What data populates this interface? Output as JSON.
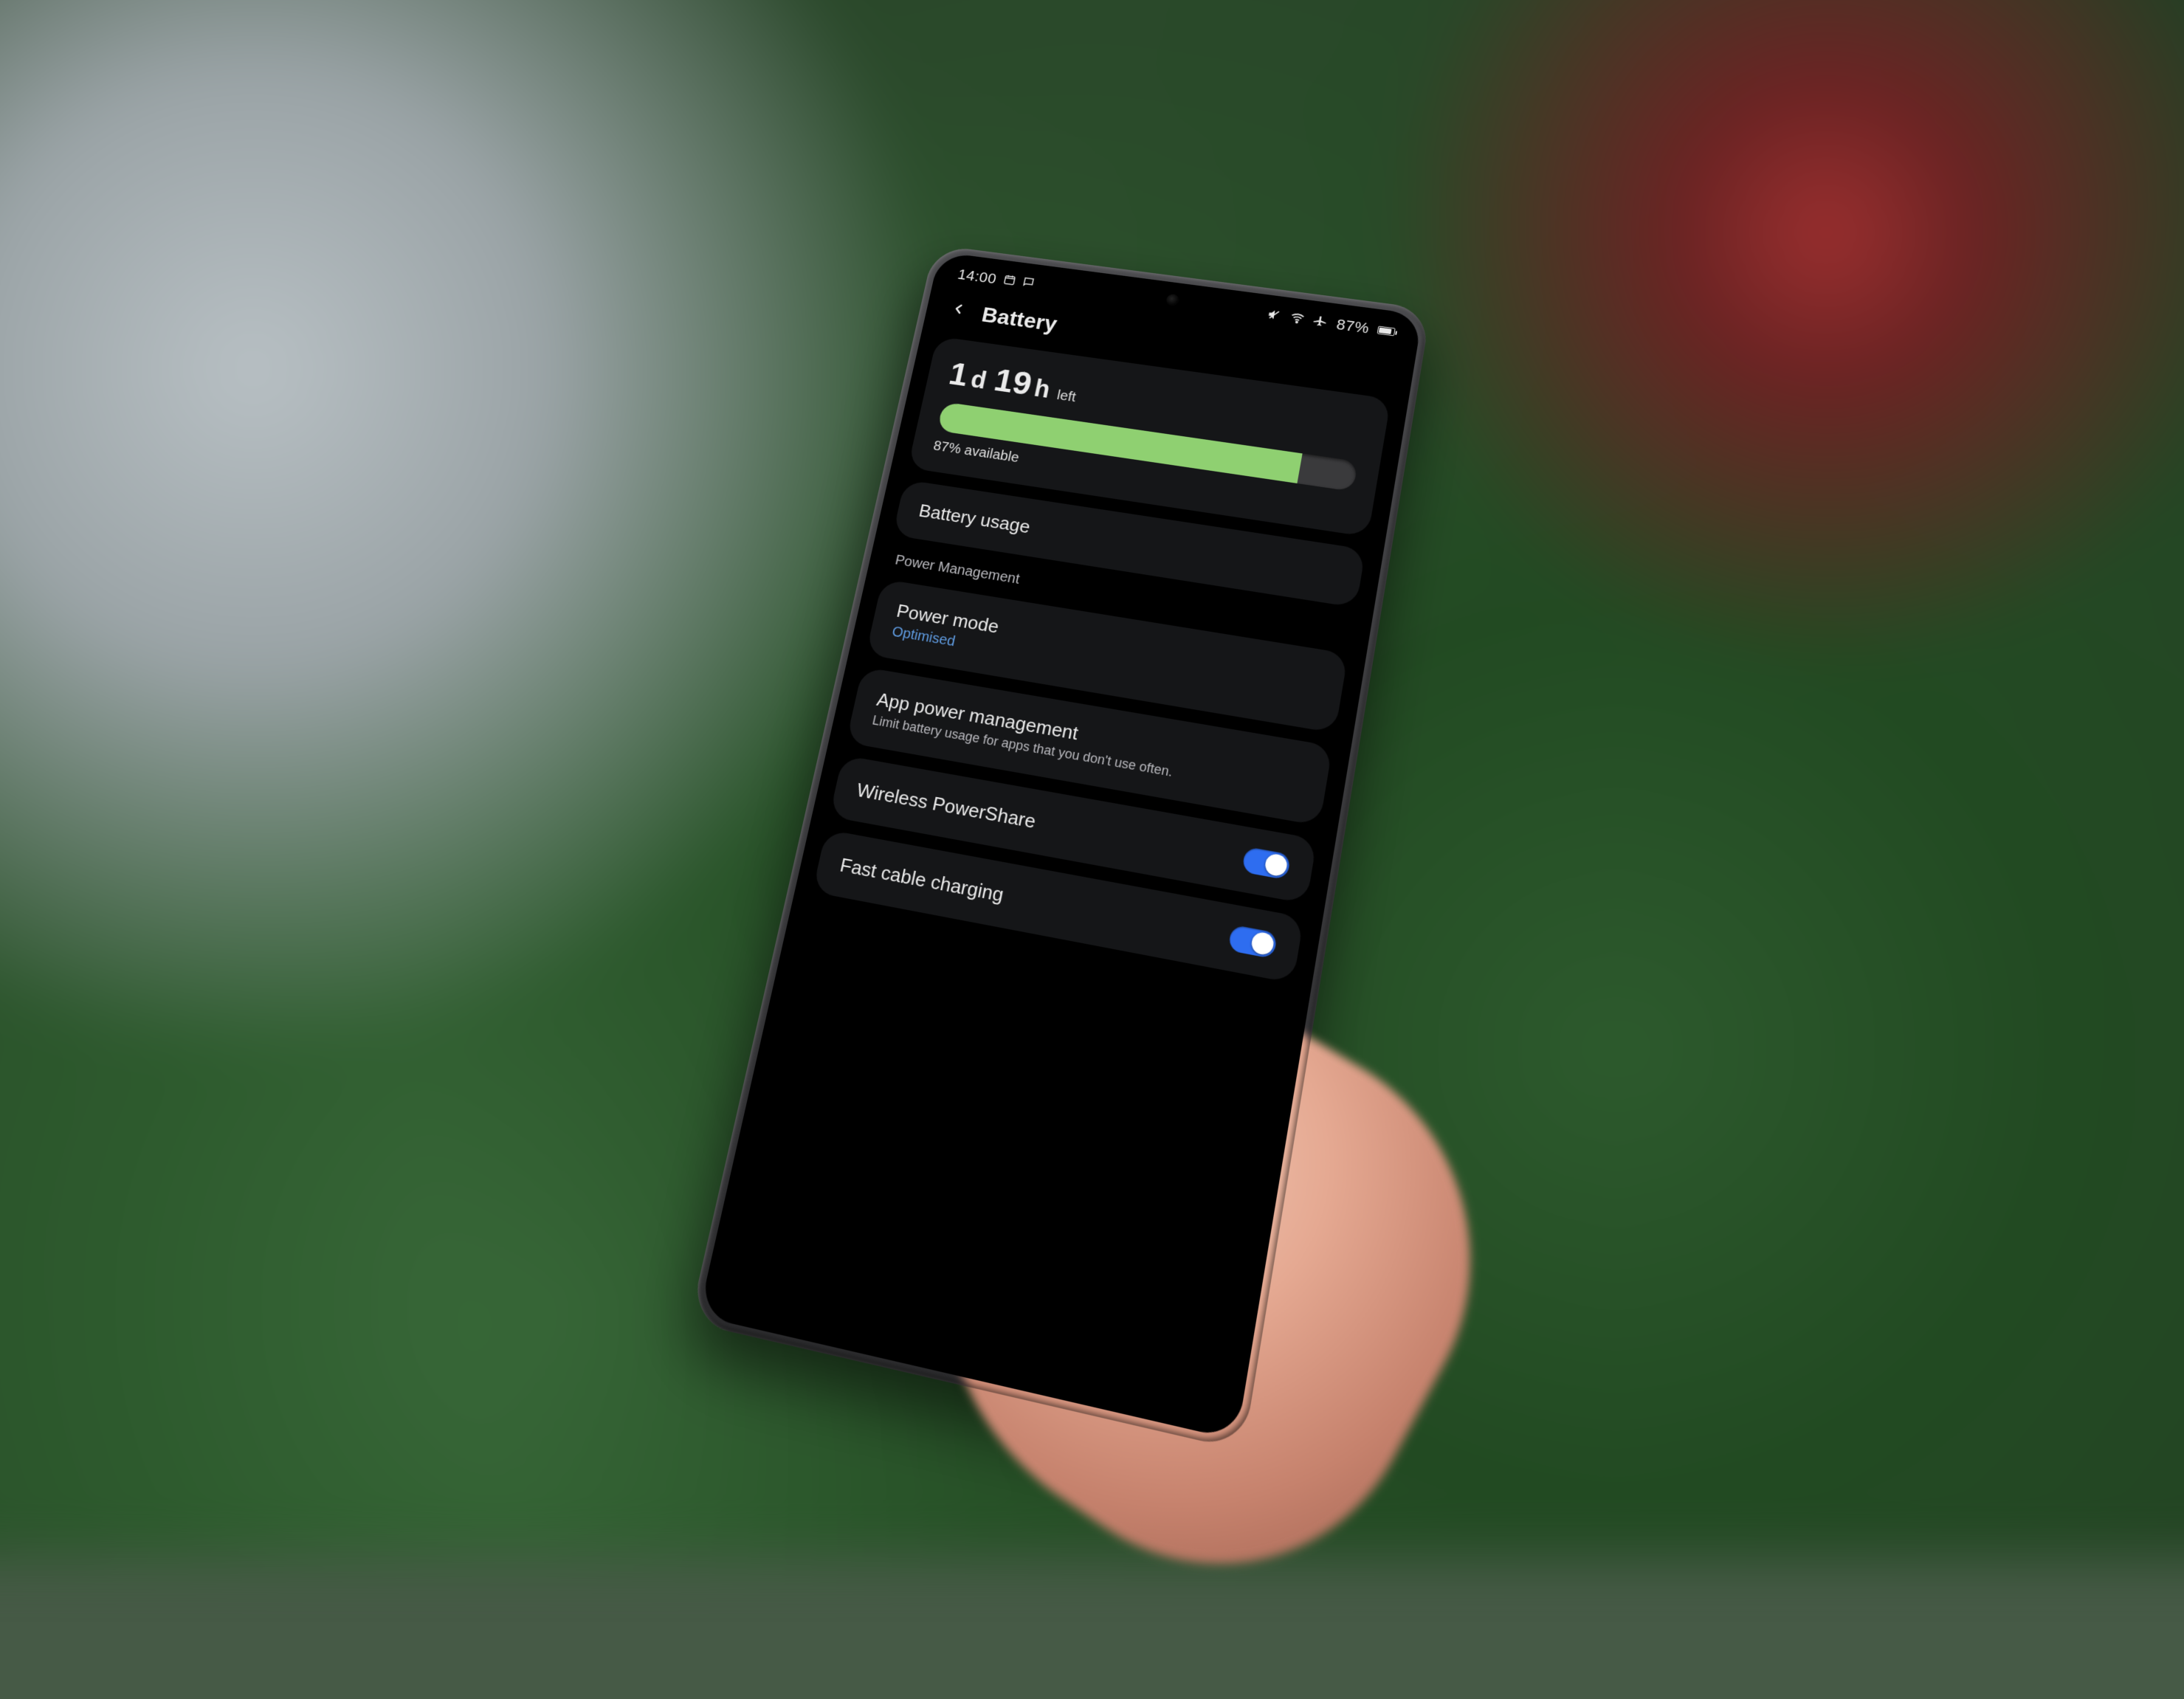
{
  "status": {
    "time": "14:00",
    "battery_percent_text": "87%",
    "battery_level": 87
  },
  "header": {
    "title": "Battery"
  },
  "estimate": {
    "days": "1",
    "days_unit": "d",
    "hours": "19",
    "hours_unit": "h",
    "suffix": "left",
    "percent": 87,
    "available_text": "87% available"
  },
  "battery_usage": {
    "label": "Battery usage"
  },
  "section_power_mgmt": "Power Management",
  "power_mode": {
    "label": "Power mode",
    "value": "Optimised"
  },
  "app_power": {
    "label": "App power management",
    "desc": "Limit battery usage for apps that you don't use often."
  },
  "powershare": {
    "label": "Wireless PowerShare",
    "on": true
  },
  "fast_charging": {
    "label": "Fast cable charging",
    "on": true
  }
}
